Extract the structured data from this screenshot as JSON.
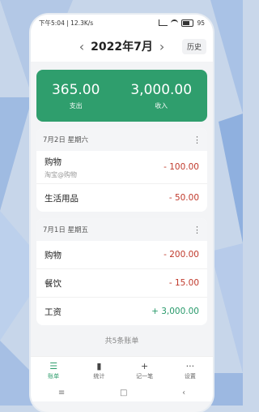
{
  "status": {
    "left": "下午5:04 | 12.3K/s",
    "battery": "95"
  },
  "header": {
    "month": "2022年7月",
    "history_label": "历史"
  },
  "summary": {
    "expense_value": "365.00",
    "expense_label": "支出",
    "income_value": "3,000.00",
    "income_label": "收入"
  },
  "groups": [
    {
      "date": "7月2日 星期六",
      "items": [
        {
          "name": "购物",
          "sub": "淘宝@购物",
          "amount": "- 100.00"
        },
        {
          "name": "生活用品",
          "sub": "",
          "amount": "- 50.00"
        }
      ]
    },
    {
      "date": "7月1日 星期五",
      "items": [
        {
          "name": "购物",
          "amount": "- 200.00"
        },
        {
          "name": "餐饮",
          "amount": "- 15.00"
        },
        {
          "name": "工资",
          "amount": "+ 3,000.00"
        }
      ]
    }
  ],
  "footer": {
    "count_text": "共5条账单"
  },
  "tabs": [
    {
      "label": "账单",
      "icon": "list-icon",
      "glyph": "☰"
    },
    {
      "label": "统计",
      "icon": "chart-icon",
      "glyph": "▮"
    },
    {
      "label": "记一笔",
      "icon": "plus-icon",
      "glyph": "+"
    },
    {
      "label": "设置",
      "icon": "more-icon",
      "glyph": "···"
    }
  ],
  "colors": {
    "accent": "#2f9e6d",
    "expense": "#c0392b",
    "income": "#27996a"
  }
}
